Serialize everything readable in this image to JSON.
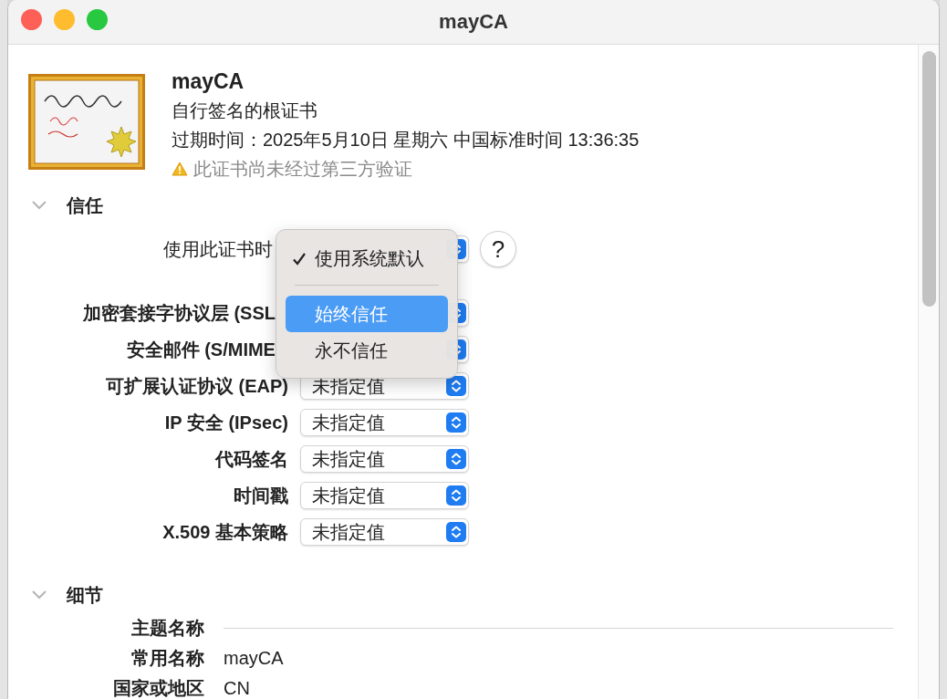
{
  "window": {
    "title": "mayCA"
  },
  "certificate": {
    "name": "mayCA",
    "subtitle": "自行签名的根证书",
    "expiry": "过期时间：2025年5月10日 星期六 中国标准时间 13:36:35",
    "warning": "此证书尚未经过第三方验证"
  },
  "trust": {
    "title": "信任",
    "expanded": true,
    "when_using": {
      "label": "使用此证书时"
    },
    "help": "?",
    "settings": [
      {
        "label": "加密套接字协议层 (SSL"
      },
      {
        "label": "安全邮件 (S/MIME"
      },
      {
        "label": "可扩展认证协议 (EAP)",
        "value": "未指定值"
      },
      {
        "label": "IP 安全 (IPsec)",
        "value": "未指定值"
      },
      {
        "label": "代码签名",
        "value": "未指定值"
      },
      {
        "label": "时间戳",
        "value": "未指定值"
      },
      {
        "label": "X.509 基本策略",
        "value": "未指定值"
      }
    ]
  },
  "menu": {
    "items": [
      {
        "kind": "option",
        "label": "使用系统默认",
        "checked": true,
        "selected": false
      },
      {
        "kind": "separator"
      },
      {
        "kind": "option",
        "label": "始终信任",
        "checked": false,
        "selected": true
      },
      {
        "kind": "option",
        "label": "永不信任",
        "checked": false,
        "selected": false
      }
    ]
  },
  "details": {
    "title": "细节",
    "expanded": true,
    "rows": [
      {
        "kind": "heading",
        "label": "主题名称"
      },
      {
        "kind": "field",
        "label": "常用名称",
        "value": "mayCA"
      },
      {
        "kind": "field",
        "label": "国家或地区",
        "value": "CN"
      }
    ]
  }
}
